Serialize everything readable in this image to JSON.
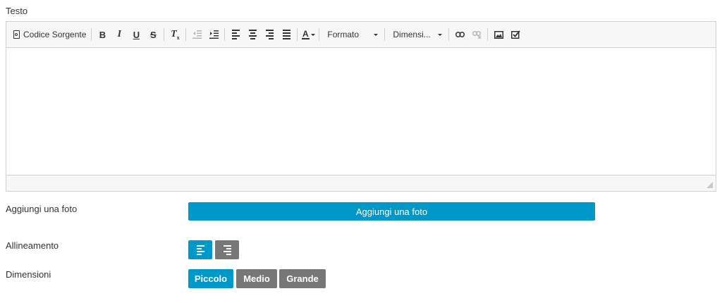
{
  "editor_field": {
    "label": "Testo",
    "toolbar": {
      "source_label": "Codice Sorgente",
      "bold_label": "B",
      "italic_label": "I",
      "underline_label": "U",
      "strike_label": "S",
      "clear_format_label": "T",
      "clear_format_sub": "x",
      "text_color_label": "A",
      "format_dropdown": "Formato",
      "size_dropdown": "Dimensi..."
    },
    "content": ""
  },
  "photo": {
    "label": "Aggiungi una foto",
    "button_label": "Aggiungi una foto"
  },
  "alignment": {
    "label": "Allineamento",
    "options": [
      {
        "icon": "align-left-icon",
        "selected": true
      },
      {
        "icon": "align-right-icon",
        "selected": false
      }
    ]
  },
  "dimensions": {
    "label": "Dimensioni",
    "options": [
      {
        "label": "Piccolo",
        "selected": true
      },
      {
        "label": "Medio",
        "selected": false
      },
      {
        "label": "Grande",
        "selected": false
      }
    ]
  },
  "colors": {
    "accent": "#0098c9",
    "inactive": "#777777",
    "toolbar_bg": "#f7f7f7",
    "border": "#d1d1d1"
  }
}
